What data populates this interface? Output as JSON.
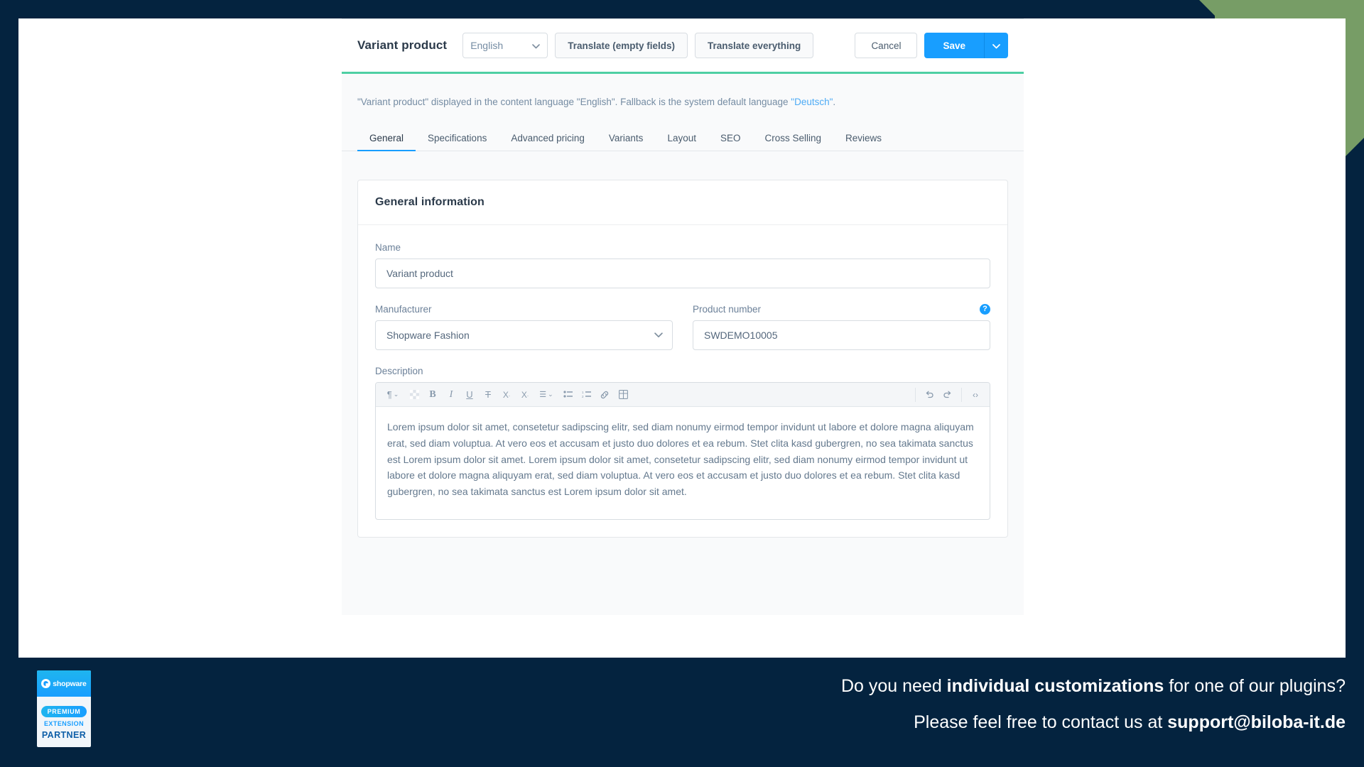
{
  "smartbar": {
    "title": "Variant product",
    "language_value": "English",
    "translate_empty_label": "Translate (empty fields)",
    "translate_all_label": "Translate everything",
    "cancel_label": "Cancel",
    "save_label": "Save",
    "chevron_icon": "chevron-down-icon"
  },
  "notice": {
    "text_before": "\"Variant product\" displayed in the content language \"English\". Fallback is the system default language ",
    "link": "\"Deutsch\"",
    "text_after": "."
  },
  "tabs": [
    {
      "label": "General",
      "active": true
    },
    {
      "label": "Specifications",
      "active": false
    },
    {
      "label": "Advanced pricing",
      "active": false
    },
    {
      "label": "Variants",
      "active": false
    },
    {
      "label": "Layout",
      "active": false
    },
    {
      "label": "SEO",
      "active": false
    },
    {
      "label": "Cross Selling",
      "active": false
    },
    {
      "label": "Reviews",
      "active": false
    }
  ],
  "card": {
    "heading": "General information",
    "name_label": "Name",
    "name_value": "Variant product",
    "manufacturer_label": "Manufacturer",
    "manufacturer_value": "Shopware Fashion",
    "product_number_label": "Product number",
    "product_number_value": "SWDEMO10005",
    "help_icon_glyph": "?",
    "description_label": "Description",
    "description_text": "Lorem ipsum dolor sit amet, consetetur sadipscing elitr, sed diam nonumy eirmod tempor invidunt ut labore et dolore magna aliquyam erat, sed diam voluptua. At vero eos et accusam et justo duo dolores et ea rebum. Stet clita kasd gubergren, no sea takimata sanctus est Lorem ipsum dolor sit amet. Lorem ipsum dolor sit amet, consetetur sadipscing elitr, sed diam nonumy eirmod tempor invidunt ut labore et dolore magna aliquyam erat, sed diam voluptua. At vero eos et accusam et justo duo dolores et ea rebum. Stet clita kasd gubergren, no sea takimata sanctus est Lorem ipsum dolor sit amet."
  },
  "editor_toolbar": {
    "left": [
      {
        "name": "paragraph-format-icon",
        "glyph": "¶"
      },
      {
        "name": "paragraph-format-chevron-icon",
        "glyph": "⌄"
      },
      {
        "name": "text-color-icon",
        "glyph": "▦"
      },
      {
        "name": "bold-icon",
        "glyph": "B"
      },
      {
        "name": "italic-icon",
        "glyph": "I"
      },
      {
        "name": "underline-icon",
        "glyph": "U"
      },
      {
        "name": "strikethrough-icon",
        "glyph": "T"
      },
      {
        "name": "superscript-icon",
        "glyph": "X"
      },
      {
        "name": "subscript-icon",
        "glyph": "X"
      },
      {
        "name": "align-icon",
        "glyph": "☰"
      },
      {
        "name": "align-chevron-icon",
        "glyph": "⌄"
      },
      {
        "name": "bullet-list-icon",
        "glyph": "≔"
      },
      {
        "name": "numbered-list-icon",
        "glyph": "⒈"
      },
      {
        "name": "link-icon",
        "glyph": "🔗"
      },
      {
        "name": "table-icon",
        "glyph": "⊞"
      }
    ],
    "right": [
      {
        "name": "undo-icon",
        "glyph": "↺"
      },
      {
        "name": "redo-icon",
        "glyph": "↻"
      },
      {
        "name": "source-code-icon",
        "glyph": "‹›"
      }
    ]
  },
  "banner": {
    "line1_before": "Do you need ",
    "line1_bold": "individual customizations",
    "line1_after": " for one of our plugins?",
    "line2_before": "Please feel free to contact us at ",
    "line2_bold": "support@biloba-it.de",
    "badge": {
      "brand": "shopware",
      "pill": "PREMIUM",
      "extension": "EXTENSION",
      "partner": "PARTNER"
    }
  },
  "colors": {
    "frame_navy": "#04233f",
    "accent_green": "#779d66",
    "divider_green": "#4ecfa3",
    "primary_blue": "#189eff",
    "link_blue": "#4dabf5"
  }
}
